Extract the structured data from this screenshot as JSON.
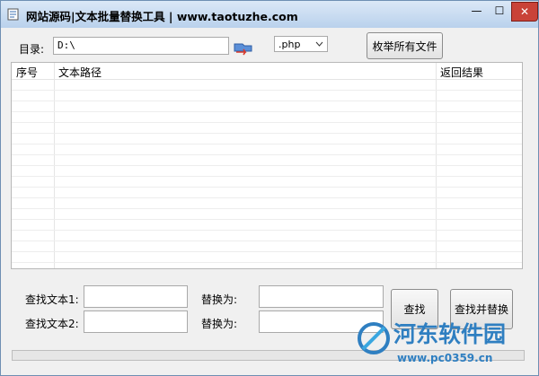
{
  "window": {
    "title": "网站源码|文本批量替换工具  | www.taotuzhe.com"
  },
  "controls": {
    "min_glyph": "—",
    "max_glyph": "☐",
    "close_glyph": "✕"
  },
  "directory": {
    "label": "目录:",
    "value": "D:\\",
    "ext_value": ".php",
    "enumerate_button": "枚举所有文件"
  },
  "table": {
    "headers": [
      "序号",
      "文本路径",
      "返回结果"
    ],
    "rows": []
  },
  "find": {
    "label1": "查找文本1:",
    "label2": "查找文本2:",
    "replace_label1": "替换为:",
    "replace_label2": "替换为:",
    "find_button": "查找",
    "find_replace_button": "查找并替换",
    "find1_value": "",
    "find2_value": "",
    "replace1_value": "",
    "replace2_value": ""
  },
  "progress": {
    "value": 0
  },
  "watermark": {
    "brand": "河东软件园",
    "url": "www.pc0359.cn"
  },
  "colors": {
    "title_gradient_top": "#dbe8f7",
    "title_gradient_bottom": "#b9d1ec",
    "close_red": "#c94238",
    "watermark_blue": "#2f7fc1"
  }
}
